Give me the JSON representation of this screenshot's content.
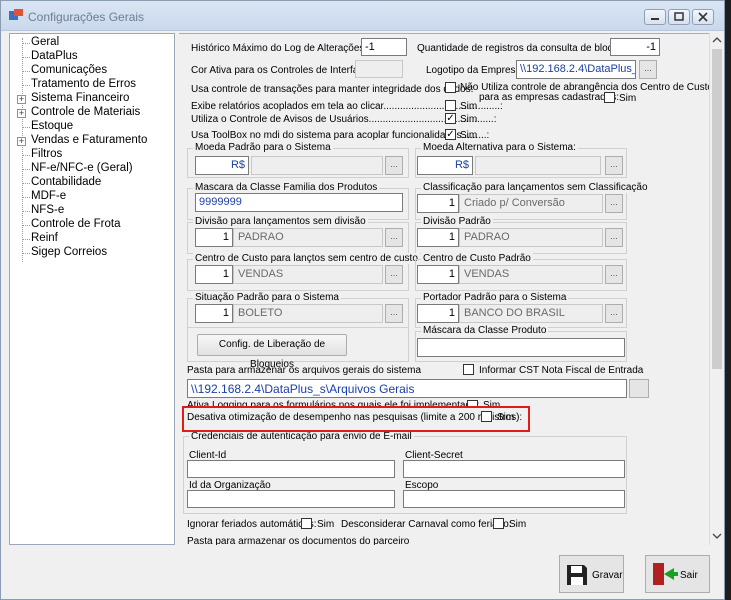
{
  "window": {
    "title": "Configurações Gerais"
  },
  "tree": {
    "items": [
      {
        "label": "Geral",
        "expand": false
      },
      {
        "label": "DataPlus",
        "expand": false
      },
      {
        "label": "Comunicações",
        "expand": false
      },
      {
        "label": "Tratamento de Erros",
        "expand": false
      },
      {
        "label": "Sistema Financeiro",
        "expand": true
      },
      {
        "label": "Controle de Materiais",
        "expand": true
      },
      {
        "label": "Estoque",
        "expand": false
      },
      {
        "label": "Vendas e Faturamento",
        "expand": true
      },
      {
        "label": "Filtros",
        "expand": false
      },
      {
        "label": "NF-e/NFC-e (Geral)",
        "expand": false
      },
      {
        "label": "Contabilidade",
        "expand": false
      },
      {
        "label": "MDF-e",
        "expand": false
      },
      {
        "label": "NFS-e",
        "expand": false
      },
      {
        "label": "Controle de Frota",
        "expand": false
      },
      {
        "label": "Reinf",
        "expand": false
      },
      {
        "label": "Sigep Correios",
        "expand": false
      }
    ]
  },
  "form": {
    "hist_label": "Histórico Máximo do Log de Alterações:",
    "hist_value": "-1",
    "qtd_label": "Quantidade de registros da consulta de bloqueio:",
    "qtd_value": "-1",
    "cor_label": "Cor Ativa para os Controles de Interface",
    "logo_label": "Logotipo da Empresa:",
    "logo_value": "\\\\192.168.2.4\\DataPlus_",
    "transacoes_label": "Usa controle de transações para manter integridade dos dados:",
    "nao_utiliza_label": "Não Utiliza controle de abrangência dos Centro de Custo",
    "nao_utiliza_label2": "para as empresas cadastradas:",
    "sim": "Sim",
    "exibe_label": "Exibe relatórios acoplados em tela ao clicar..........................................:",
    "avisos_label": "Utiliza o Controle de Avisos de Usuários.............................................:",
    "toolbox_label": "Usa ToolBox no mdi do sistema para acoplar funcionalidades.........:",
    "moeda_padrao_label": "Moeda Padrão para o Sistema",
    "moeda_padrao_value": "R$",
    "moeda_alt_label": "Moeda Alternativa para o Sistema:",
    "moeda_alt_value": "R$",
    "mascara_familia_label": "Mascara da Classe Familia dos Produtos",
    "mascara_familia_value": "9999999",
    "classificacao_label": "Classificação para lançamentos sem Classificação",
    "classificacao_num": "1",
    "classificacao_value": "Criado p/ Conversão",
    "divisao_lanc_label": "Divisão para lançamentos sem divisão",
    "divisao_lanc_num": "1",
    "divisao_lanc_value": "PADRAO",
    "divisao_padrao_label": "Divisão Padrão",
    "divisao_padrao_num": "1",
    "divisao_padrao_value": "PADRAO",
    "cc_lanc_label": "Centro de Custo para lançtos sem centro de custo",
    "cc_lanc_num": "1",
    "cc_lanc_value": "VENDAS",
    "cc_padrao_label": "Centro de Custo Padrão",
    "cc_padrao_num": "1",
    "cc_padrao_value": "VENDAS",
    "situacao_label": "Situação Padrão para o Sistema",
    "situacao_num": "1",
    "situacao_value": "BOLETO",
    "portador_label": "Portador Padrão para o Sistema",
    "portador_num": "1",
    "portador_value": "BANCO DO BRASIL",
    "mascara_produto_label": "Máscara da Classe Produto",
    "config_bloqueios_btn": "Config. de Liberação de Bloqueios",
    "pasta_label": "Pasta para armazenar os arquivos gerais do sistema",
    "cst_label": "Informar CST Nota Fiscal de Entrada",
    "pasta_value": "\\\\192.168.2.4\\DataPlus_s\\Arquivos Gerais",
    "logging_label": "Ativa Logging para os formulários nos quais ele foi implementado:",
    "desativa_label": "Desativa otimização de desempenho nas pesquisas (limite a 200 registros):",
    "credenciais_label": "Credenciais de autenticação para envio de E-mail",
    "client_id_label": "Client-Id",
    "client_secret_label": "Client-Secret",
    "id_org_label": "Id da Organização",
    "escopo_label": "Escopo",
    "ignorar_label": "Ignorar feriados automáticos:",
    "carnaval_label": "Desconsiderar Carnaval como feriado:",
    "pasta_parceiro_label": "Pasta para armazenar os documentos do parceiro"
  },
  "buttons": {
    "gravar": "Gravar",
    "sair": "Sair"
  },
  "checks": {
    "transacoes": false,
    "nao_utiliza": false,
    "exibe": false,
    "avisos": true,
    "toolbox": true,
    "cst": false,
    "logging": false,
    "desativa": false,
    "ignorar": false,
    "carnaval": false
  },
  "colors": {
    "highlight": "#e01b1b",
    "path_text": "#1a3ea8"
  }
}
